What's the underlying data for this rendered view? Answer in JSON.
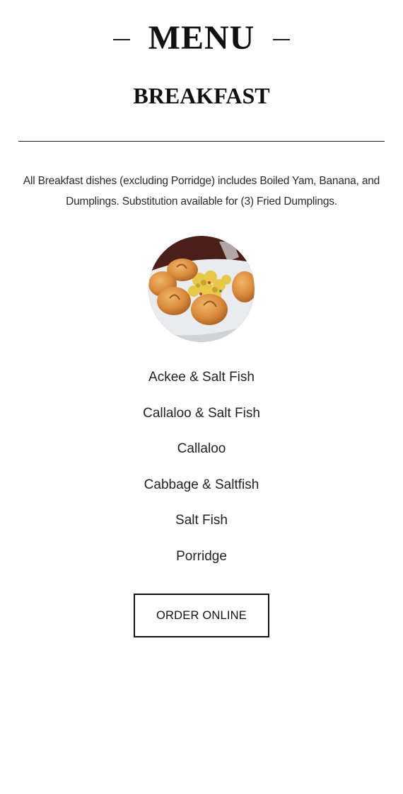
{
  "header": {
    "title": "MENU"
  },
  "section": {
    "title": "BREAKFAST",
    "note": "All Breakfast dishes (excluding Porridge) includes Boiled Yam, Banana, and Dumplings. Substitution available for (3) Fried Dumplings."
  },
  "photo": {
    "icon": "breakfast-dish-photo"
  },
  "items": [
    {
      "label": "Ackee & Salt Fish"
    },
    {
      "label": "Callaloo & Salt Fish"
    },
    {
      "label": "Callaloo"
    },
    {
      "label": "Cabbage & Saltfish"
    },
    {
      "label": "Salt Fish"
    },
    {
      "label": "Porridge"
    }
  ],
  "cta": {
    "label": "ORDER ONLINE"
  }
}
